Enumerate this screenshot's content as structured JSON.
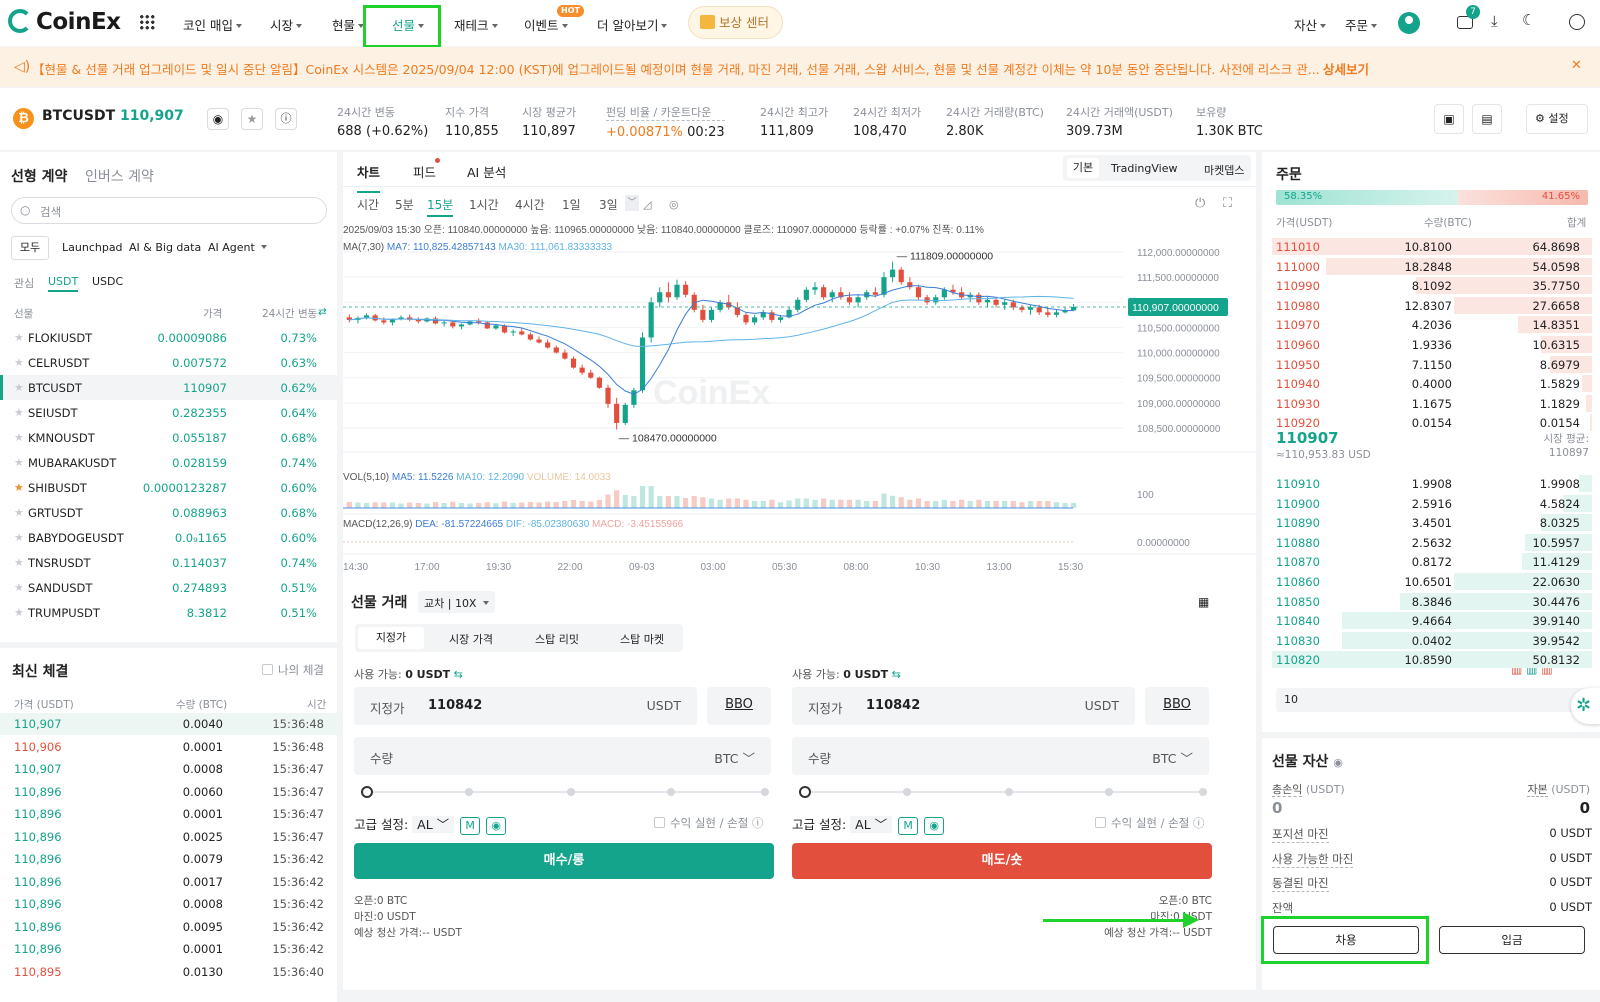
{
  "nav": {
    "logo": "CoinEx",
    "items": [
      {
        "label": "코인 매입",
        "caret": true
      },
      {
        "label": "시장",
        "caret": true
      },
      {
        "label": "현물",
        "caret": true
      },
      {
        "label": "선물",
        "caret": true
      },
      {
        "label": "재테크",
        "caret": true
      },
      {
        "label": "이벤트",
        "caret": true
      },
      {
        "label": "더 알아보기",
        "caret": true
      }
    ],
    "hot_badge": "HOT",
    "reward_center": "보상 센터",
    "assets": "자산",
    "orders": "주문",
    "notification_count": "7"
  },
  "notice": {
    "text": "【현물 & 선물 거래 업그레이드 및 일시 중단 알림】CoinEx 시스템은 2025/09/04 12:00 (KST)에 업그레이드될 예정이며 현물 거래, 마진 거래, 선물 거래, 스왑 서비스, 현물 및 선물 계정간 이체는 약 10분 동안 중단됩니다. 사전에 리스크 관...",
    "more": "상세보기"
  },
  "ticker": {
    "symbol": "BTCUSDT",
    "price": "110,907",
    "stats": [
      {
        "label": "24시간 변동",
        "value": "688 (+0.62%)",
        "color": "green"
      },
      {
        "label": "지수 가격",
        "value": "110,855"
      },
      {
        "label": "시장 평균가",
        "value": "110,897"
      },
      {
        "label": "펀딩 비율 / 카운트다운",
        "value": "+0.00871%",
        "value2": "00:23",
        "color": "orange"
      },
      {
        "label": "24시간 최고가",
        "value": "111,809"
      },
      {
        "label": "24시간 최저가",
        "value": "108,470"
      },
      {
        "label": "24시간 거래량(BTC)",
        "value": "2.80K"
      },
      {
        "label": "24시간 거래액(USDT)",
        "value": "309.73M"
      },
      {
        "label": "보유량",
        "value": "1.30K BTC"
      }
    ],
    "settings": "설정"
  },
  "markets": {
    "tabs": [
      "선형 계약",
      "인버스 계약"
    ],
    "search_placeholder": "검색",
    "filters": [
      "모두",
      "Launchpad",
      "AI & Big data",
      "AI Agent"
    ],
    "subtabs": [
      "관심",
      "USDT",
      "USDC"
    ],
    "headers": [
      "선물",
      "가격",
      "24시간 변동"
    ],
    "rows": [
      {
        "name": "FLOKIUSDT",
        "price": "0.00009086",
        "change": "0.73%"
      },
      {
        "name": "CELRUSDT",
        "price": "0.007572",
        "change": "0.63%"
      },
      {
        "name": "BTCUSDT",
        "price": "110907",
        "change": "0.62%"
      },
      {
        "name": "SEIUSDT",
        "price": "0.282355",
        "change": "0.64%"
      },
      {
        "name": "KMNOUSDT",
        "price": "0.055187",
        "change": "0.68%"
      },
      {
        "name": "MUBARAKUSDT",
        "price": "0.028159",
        "change": "0.74%"
      },
      {
        "name": "SHIBUSDT",
        "price": "0.0000123287",
        "change": "0.60%",
        "fav": true
      },
      {
        "name": "GRTUSDT",
        "price": "0.088963",
        "change": "0.68%"
      },
      {
        "name": "BABYDOGEUSDT",
        "price": "0.0₉1165",
        "change": "0.60%"
      },
      {
        "name": "TNSRUSDT",
        "price": "0.114037",
        "change": "0.74%"
      },
      {
        "name": "SANDUSDT",
        "price": "0.274893",
        "change": "0.51%"
      },
      {
        "name": "TRUMPUSDT",
        "price": "8.3812",
        "change": "0.51%"
      }
    ]
  },
  "trades": {
    "title": "최신 체결",
    "my_trades": "나의 체결",
    "headers": [
      "가격 (USDT)",
      "수량 (BTC)",
      "시간"
    ],
    "rows": [
      {
        "price": "110,907",
        "qty": "0.0040",
        "time": "15:36:48",
        "side": "buy"
      },
      {
        "price": "110,906",
        "qty": "0.0001",
        "time": "15:36:48",
        "side": "sell"
      },
      {
        "price": "110,907",
        "qty": "0.0008",
        "time": "15:36:47",
        "side": "buy"
      },
      {
        "price": "110,896",
        "qty": "0.0060",
        "time": "15:36:47",
        "side": "buy"
      },
      {
        "price": "110,896",
        "qty": "0.0001",
        "time": "15:36:47",
        "side": "buy"
      },
      {
        "price": "110,896",
        "qty": "0.0025",
        "time": "15:36:47",
        "side": "buy"
      },
      {
        "price": "110,896",
        "qty": "0.0079",
        "time": "15:36:42",
        "side": "buy"
      },
      {
        "price": "110,896",
        "qty": "0.0017",
        "time": "15:36:42",
        "side": "buy"
      },
      {
        "price": "110,896",
        "qty": "0.0008",
        "time": "15:36:42",
        "side": "buy"
      },
      {
        "price": "110,896",
        "qty": "0.0095",
        "time": "15:36:42",
        "side": "buy"
      },
      {
        "price": "110,896",
        "qty": "0.0001",
        "time": "15:36:42",
        "side": "buy"
      },
      {
        "price": "110,895",
        "qty": "0.0130",
        "time": "15:36:40",
        "side": "sell"
      }
    ]
  },
  "chart": {
    "tabs": [
      "차트",
      "피드",
      "AI 분석"
    ],
    "views": [
      "기본",
      "TradingView",
      "마켓뎁스"
    ],
    "intervals": [
      "시간",
      "5분",
      "15분",
      "1시간",
      "4시간",
      "1일",
      "3일"
    ],
    "active_interval": "15분",
    "ohlc_line": "2025/09/03 15:30  오픈: 110840.00000000  높음: 110965.00000000  낮음: 110840.00000000  클로즈: 110907.00000000  등락률 : +0.07%  진폭: 0.11%",
    "ma_label": "MA(7,30)",
    "ma7": "MA7: 110,825.42857143",
    "ma30": "MA30: 111,061.83333333",
    "price_axis": [
      "112,000.00000000",
      "111,500.00000000",
      "111,000.00000000",
      "110,500.00000000",
      "110,000.00000000",
      "109,500.00000000",
      "109,000.00000000",
      "108,500.00000000"
    ],
    "current_price_tag": "110,907.00000000",
    "high_annot": "111809.00000000",
    "low_annot": "108470.00000000",
    "vol_label": "VOL(5,10)",
    "vol_ma5": "MA5: 11.5226",
    "vol_ma10": "MA10: 12.2090",
    "vol_volume": "VOLUME: 14.0033",
    "vol_axis": "100",
    "macd_label": "MACD(12,26,9)",
    "macd_dea": "DEA: -81.57224665",
    "macd_dif": "DIF: -85.02380630",
    "macd_val": "MACD: -3.45155966",
    "macd_axis": "0.00000000",
    "time_axis": [
      "14:30",
      "17:00",
      "19:30",
      "22:00",
      "09-03",
      "03:00",
      "05:30",
      "08:00",
      "10:30",
      "13:00",
      "15:30"
    ],
    "watermark": "CoinEx"
  },
  "chart_data": {
    "type": "candlestick",
    "title": "",
    "x": [
      "14:30",
      "17:00",
      "19:30",
      "22:00",
      "09-03",
      "03:00",
      "05:30",
      "08:00",
      "10:30",
      "13:00",
      "15:30"
    ],
    "ylim": [
      108300,
      112200
    ],
    "candles": [
      [
        110700,
        110760,
        110600,
        110650
      ],
      [
        110650,
        110720,
        110580,
        110690
      ],
      [
        110690,
        110780,
        110660,
        110740
      ],
      [
        110740,
        110770,
        110620,
        110640
      ],
      [
        110640,
        110700,
        110560,
        110600
      ],
      [
        110600,
        110680,
        110540,
        110660
      ],
      [
        110660,
        110740,
        110640,
        110700
      ],
      [
        110700,
        110760,
        110620,
        110650
      ],
      [
        110650,
        110700,
        110580,
        110620
      ],
      [
        110620,
        110700,
        110600,
        110680
      ],
      [
        110680,
        110720,
        110560,
        110580
      ],
      [
        110580,
        110640,
        110520,
        110600
      ],
      [
        110600,
        110650,
        110480,
        110520
      ],
      [
        110520,
        110580,
        110460,
        110560
      ],
      [
        110560,
        110640,
        110540,
        110620
      ],
      [
        110620,
        110680,
        110560,
        110600
      ],
      [
        110600,
        110620,
        110470,
        110480
      ],
      [
        110480,
        110560,
        110450,
        110540
      ],
      [
        110540,
        110560,
        110380,
        110400
      ],
      [
        110400,
        110460,
        110330,
        110420
      ],
      [
        110420,
        110480,
        110340,
        110360
      ],
      [
        110360,
        110400,
        110240,
        110260
      ],
      [
        110260,
        110320,
        110180,
        110200
      ],
      [
        110200,
        110260,
        110080,
        110100
      ],
      [
        110100,
        110140,
        109980,
        110000
      ],
      [
        110000,
        110060,
        109860,
        109880
      ],
      [
        109880,
        109920,
        109680,
        109700
      ],
      [
        109700,
        109760,
        109560,
        109600
      ],
      [
        109600,
        109660,
        109480,
        109500
      ],
      [
        109500,
        109520,
        109280,
        109300
      ],
      [
        109300,
        109360,
        108900,
        108980
      ],
      [
        108980,
        109100,
        108470,
        108600
      ],
      [
        108600,
        109000,
        108560,
        108960
      ],
      [
        108960,
        109300,
        108900,
        109250
      ],
      [
        109250,
        110400,
        109200,
        110300
      ],
      [
        110300,
        111100,
        110200,
        111000
      ],
      [
        111000,
        111300,
        110900,
        111200
      ],
      [
        111200,
        111400,
        111000,
        111100
      ],
      [
        111100,
        111450,
        111050,
        111350
      ],
      [
        111350,
        111420,
        111100,
        111150
      ],
      [
        111150,
        111200,
        110800,
        110850
      ],
      [
        110850,
        110950,
        110600,
        110650
      ],
      [
        110650,
        110900,
        110600,
        110850
      ],
      [
        110850,
        111050,
        110800,
        111000
      ],
      [
        111000,
        111150,
        110850,
        110900
      ],
      [
        110900,
        111000,
        110700,
        110750
      ],
      [
        110750,
        110800,
        110550,
        110600
      ],
      [
        110600,
        110750,
        110550,
        110700
      ],
      [
        110700,
        110850,
        110650,
        110800
      ],
      [
        110800,
        110850,
        110600,
        110650
      ],
      [
        110650,
        110750,
        110600,
        110700
      ],
      [
        110700,
        110900,
        110680,
        110850
      ],
      [
        110850,
        111100,
        110800,
        111050
      ],
      [
        111050,
        111300,
        111000,
        111250
      ],
      [
        111250,
        111400,
        111150,
        111300
      ],
      [
        111300,
        111350,
        111050,
        111100
      ],
      [
        111100,
        111250,
        111000,
        111200
      ],
      [
        111200,
        111300,
        111050,
        111100
      ],
      [
        111100,
        111200,
        110950,
        111000
      ],
      [
        111000,
        111150,
        110900,
        111100
      ],
      [
        111100,
        111250,
        111050,
        111200
      ],
      [
        111200,
        111300,
        111100,
        111150
      ],
      [
        111150,
        111600,
        111100,
        111500
      ],
      [
        111500,
        111809,
        111400,
        111650
      ],
      [
        111650,
        111700,
        111350,
        111400
      ],
      [
        111400,
        111500,
        111250,
        111300
      ],
      [
        111300,
        111350,
        111050,
        111100
      ],
      [
        111100,
        111150,
        110950,
        111000
      ],
      [
        111000,
        111150,
        110950,
        111100
      ],
      [
        111100,
        111300,
        111050,
        111250
      ],
      [
        111250,
        111350,
        111150,
        111200
      ],
      [
        111200,
        111300,
        111050,
        111100
      ],
      [
        111100,
        111200,
        111000,
        111150
      ],
      [
        111150,
        111200,
        110950,
        111000
      ],
      [
        111000,
        111100,
        110900,
        111050
      ],
      [
        111050,
        111100,
        110900,
        110950
      ],
      [
        110950,
        111050,
        110850,
        111000
      ],
      [
        111000,
        111050,
        110850,
        110900
      ],
      [
        110900,
        110950,
        110800,
        110850
      ],
      [
        110850,
        110950,
        110750,
        110900
      ],
      [
        110900,
        110950,
        110750,
        110800
      ],
      [
        110800,
        110900,
        110700,
        110750
      ],
      [
        110750,
        110850,
        110700,
        110800
      ],
      [
        110800,
        110900,
        110780,
        110840
      ],
      [
        110840,
        110965,
        110840,
        110907
      ]
    ]
  },
  "futures": {
    "title": "선물 거래",
    "mode": "교차 | 10X",
    "order_tabs": [
      "지정가",
      "시장 가격",
      "스탑 리밋",
      "스탑 마켓"
    ],
    "available_label": "사용 가능:",
    "available_value": "0 USDT",
    "price_label": "지정가",
    "price_value": "110842",
    "price_unit": "USDT",
    "bbo": "BBO",
    "qty_label": "수량",
    "qty_unit": "BTC",
    "adv_label": "고급 설정:",
    "adv_value": "AL",
    "m_chip": "M",
    "tpsl": "수익 실현 / 손절",
    "buy": "매수/롱",
    "sell": "매도/숏",
    "open_label": "오픈:0 BTC",
    "margin_label": "마진:0 USDT",
    "liq_label": "예상 청산 가격:-- USDT"
  },
  "orderbook": {
    "title": "주문",
    "buy_pct": "58.35%",
    "sell_pct": "41.65%",
    "buy_ratio": 0.5835,
    "headers": [
      "가격(USDT)",
      "수량(BTC)",
      "합계"
    ],
    "asks": [
      {
        "price": "111010",
        "qty": "10.8100",
        "total": "64.8698",
        "depth": 1.0
      },
      {
        "price": "111000",
        "qty": "18.2848",
        "total": "54.0598",
        "depth": 0.83
      },
      {
        "price": "110990",
        "qty": "8.1092",
        "total": "35.7750",
        "depth": 0.55
      },
      {
        "price": "110980",
        "qty": "12.8307",
        "total": "27.6658",
        "depth": 0.43
      },
      {
        "price": "110970",
        "qty": "4.2036",
        "total": "14.8351",
        "depth": 0.23
      },
      {
        "price": "110960",
        "qty": "1.9336",
        "total": "10.6315",
        "depth": 0.16
      },
      {
        "price": "110950",
        "qty": "7.1150",
        "total": "8.6979",
        "depth": 0.13
      },
      {
        "price": "110940",
        "qty": "0.4000",
        "total": "1.5829",
        "depth": 0.03
      },
      {
        "price": "110930",
        "qty": "1.1675",
        "total": "1.1829",
        "depth": 0.02
      },
      {
        "price": "110920",
        "qty": "0.0154",
        "total": "0.0154",
        "depth": 0.005
      }
    ],
    "mid_price": "110907",
    "mid_usd": "≈110,953.83 USD",
    "avg_label": "시장 평균:",
    "avg_value": "110897",
    "bids": [
      {
        "price": "110910",
        "qty": "1.9908",
        "total": "1.9908",
        "depth": 0.04
      },
      {
        "price": "110900",
        "qty": "2.5916",
        "total": "4.5824",
        "depth": 0.09
      },
      {
        "price": "110890",
        "qty": "3.4501",
        "total": "8.0325",
        "depth": 0.16
      },
      {
        "price": "110880",
        "qty": "2.5632",
        "total": "10.5957",
        "depth": 0.21
      },
      {
        "price": "110870",
        "qty": "0.8172",
        "total": "11.4129",
        "depth": 0.22
      },
      {
        "price": "110860",
        "qty": "10.6501",
        "total": "22.0630",
        "depth": 0.43
      },
      {
        "price": "110850",
        "qty": "8.3846",
        "total": "30.4476",
        "depth": 0.6
      },
      {
        "price": "110840",
        "qty": "9.4664",
        "total": "39.9140",
        "depth": 0.78
      },
      {
        "price": "110830",
        "qty": "0.0402",
        "total": "39.9542",
        "depth": 0.78
      },
      {
        "price": "110820",
        "qty": "10.8590",
        "total": "50.8132",
        "depth": 1.0
      }
    ],
    "depth_step": "10"
  },
  "assets": {
    "title": "선물 자산",
    "pnl_label": "총손익",
    "pnl_unit": "(USDT)",
    "pnl_value": "0",
    "equity_label": "자본",
    "equity_unit": "(USDT)",
    "equity_value": "0",
    "rows": [
      {
        "label": "포지션 마진",
        "value": "0 USDT"
      },
      {
        "label": "사용 가능한 마진",
        "value": "0 USDT"
      },
      {
        "label": "동결된 마진",
        "value": "0 USDT"
      },
      {
        "label": "잔액",
        "value": "0 USDT"
      }
    ],
    "borrow": "차용",
    "deposit": "입금"
  }
}
